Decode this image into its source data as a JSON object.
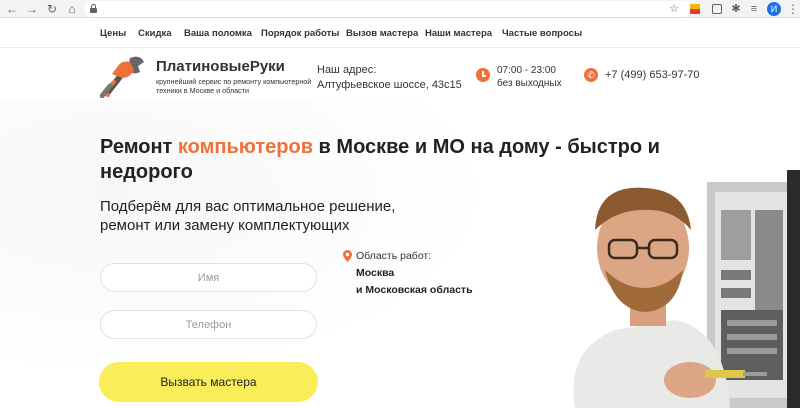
{
  "browser": {
    "back_icon": "arrow-left-icon",
    "forward_icon": "arrow-right-icon",
    "reload_icon": "reload-icon",
    "home_icon": "home-icon",
    "address": "",
    "profile_initial": "И"
  },
  "nav": {
    "items": [
      {
        "label": "Цены"
      },
      {
        "label": "Скидка"
      },
      {
        "label": "Ваша поломка"
      },
      {
        "label": "Порядок работы"
      },
      {
        "label": "Вызов мастера"
      },
      {
        "label": "Наши мастера"
      },
      {
        "label": "Частые вопросы"
      }
    ]
  },
  "header": {
    "brand": "ПлатиновыеРуки",
    "tagline": "крупнейший сервис по ремонту компьютерной техники в Москве и области",
    "address_label": "Наш адрес:",
    "address_value": "Алтуфьевское шоссе, 43с15",
    "hours_line1": "07:00 - 23:00",
    "hours_line2": "без выходных",
    "phone": "+7 (499) 653-97-70"
  },
  "hero": {
    "headline_part1": "Ремонт ",
    "headline_accent": "компьютеров",
    "headline_part2": " в Москве и МО на дому - быстро и недорого",
    "subhead": "Подберём для вас оптимальное решение, ремонт или замену комплектующих"
  },
  "form": {
    "name_placeholder": "Имя",
    "phone_placeholder": "Телефон",
    "submit_label": "Вызвать мастера"
  },
  "service_area": {
    "label": "Область работ:",
    "city": "Москва",
    "region": "и Московская область"
  },
  "colors": {
    "accent": "#f0703a",
    "button": "#f9ee5a",
    "profile": "#1a73e8"
  }
}
